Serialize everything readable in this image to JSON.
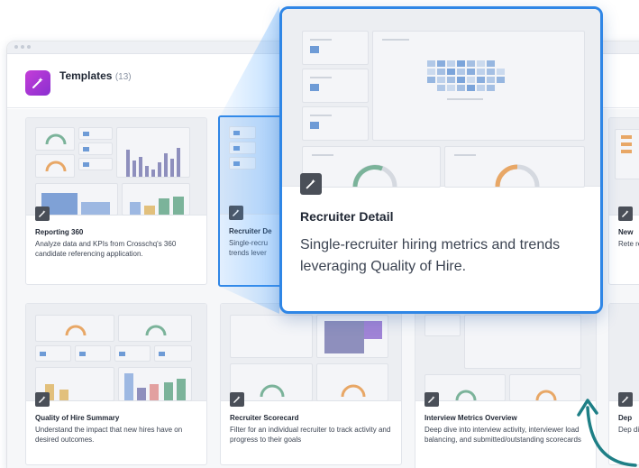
{
  "header": {
    "title": "Templates",
    "count": "(13)"
  },
  "icons": {
    "app": "wand-icon",
    "badge": "wand-icon",
    "arrow": "curved-arrow-icon"
  },
  "colors": {
    "accent": "#2f86e6",
    "app_icon": "#b03ad6",
    "arrow": "#1e7f86"
  },
  "cards": [
    {
      "title": "Reporting 360",
      "desc": "Analyze data and KPIs from Crosschq's 360 candidate referencing application."
    },
    {
      "title": "Recruiter De",
      "desc": "Single-recru trends lever"
    },
    {
      "title": "New",
      "desc": "Rete recr"
    },
    {
      "title": "Quality of Hire Summary",
      "desc": "Understand the impact that new hires have on desired outcomes."
    },
    {
      "title": "Recruiter Scorecard",
      "desc": "Filter for an individual recruiter to track activity and progress to their goals"
    },
    {
      "title": "Interview Metrics Overview",
      "desc": "Deep dive into interview activity, interviewer load balancing, and submitted/outstanding scorecards"
    },
    {
      "title": "Dep",
      "desc": "Dep dive"
    }
  ],
  "popup": {
    "title": "Recruiter Detail",
    "desc": "Single-recruiter hiring metrics and trends leveraging Quality of Hire."
  }
}
